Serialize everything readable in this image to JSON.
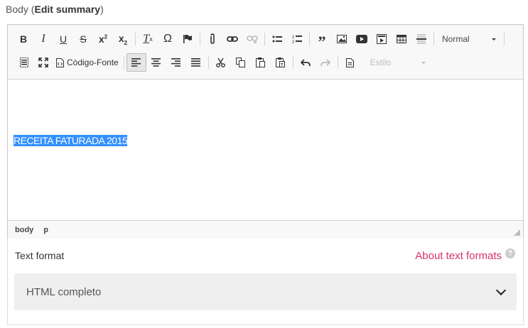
{
  "field": {
    "name": "Body",
    "summary_link": "Edit summary"
  },
  "toolbar": {
    "source_label": "Código-Fonte",
    "format_combo": "Normal",
    "style_combo": "Estilo"
  },
  "content": {
    "selected_text": "RECEITA FATURADA 2015"
  },
  "elements_path": [
    "body",
    "p"
  ],
  "text_format": {
    "label": "Text format",
    "about_link": "About text formats",
    "help": "?",
    "selected": "HTML completo"
  }
}
